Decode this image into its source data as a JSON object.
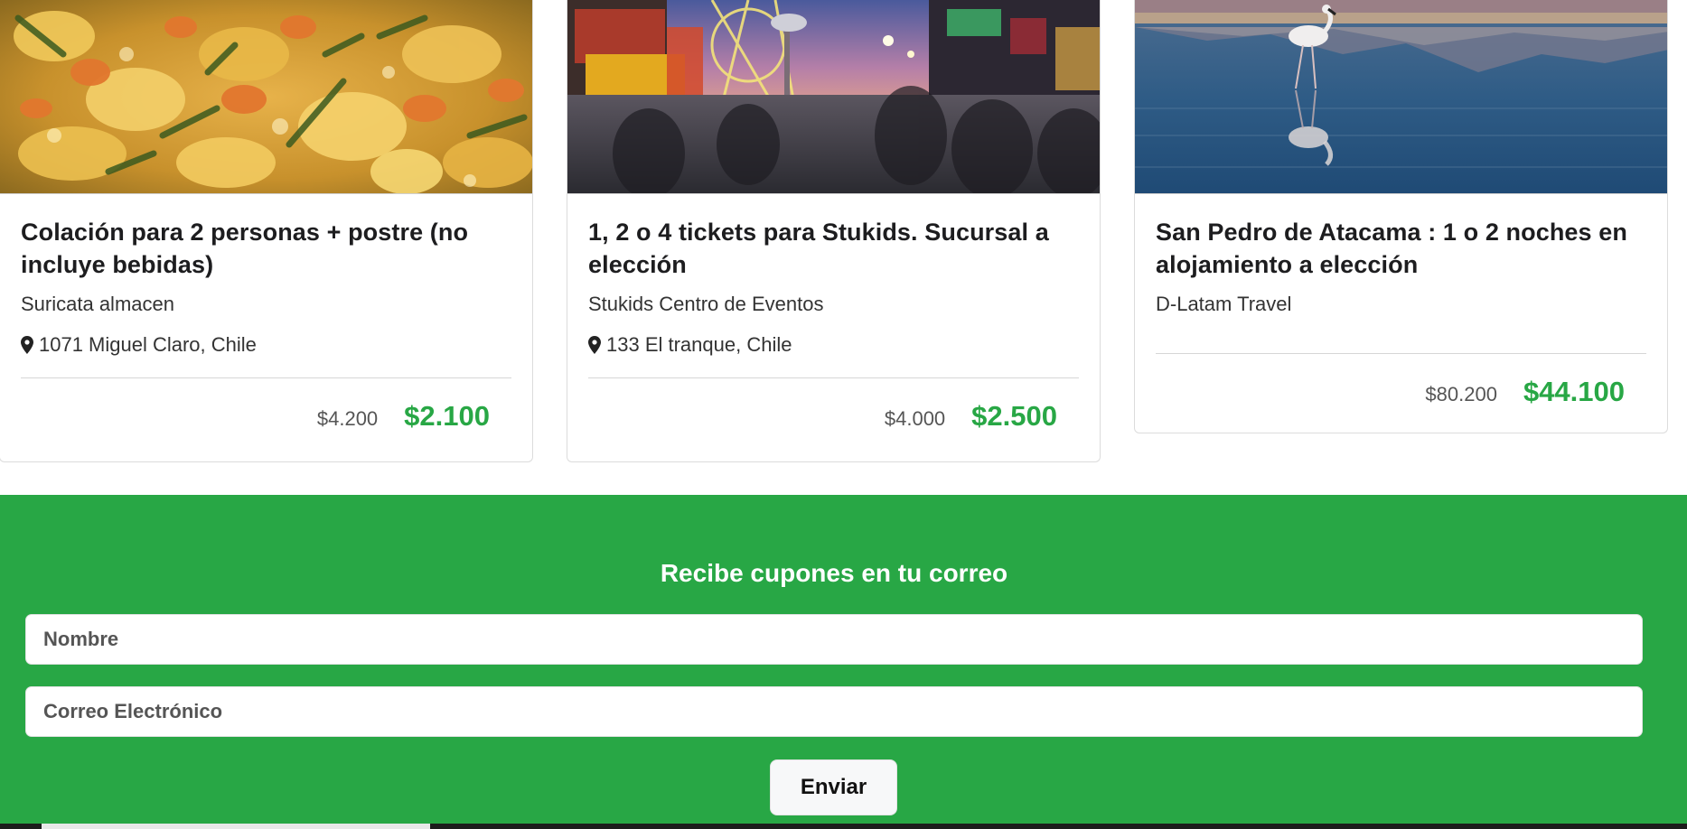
{
  "deals": [
    {
      "title": "Colación para 2 personas + postre (no incluye bebidas)",
      "merchant": "Suricata almacen",
      "location": "1071 Miguel Claro, Chile",
      "old_price": "$4.200",
      "new_price": "$2.100",
      "image": "food-photo"
    },
    {
      "title": "1, 2 o 4 tickets para Stukids. Sucursal a elección",
      "merchant": "Stukids Centro de Eventos",
      "location": "133 El tranque, Chile",
      "old_price": "$4.000",
      "new_price": "$2.500",
      "image": "amusement-park-photo"
    },
    {
      "title": "San Pedro de Atacama : 1 o 2 noches en alojamiento a elección",
      "merchant": "D-Latam Travel",
      "location": "",
      "old_price": "$80.200",
      "new_price": "$44.100",
      "image": "flamingo-lagoon-photo"
    }
  ],
  "newsletter": {
    "title": "Recibe cupones en tu correo",
    "name_placeholder": "Nombre",
    "email_placeholder": "Correo Electrónico",
    "submit_label": "Enviar"
  },
  "colors": {
    "accent_green": "#28a745",
    "price_green": "#28a745",
    "text_dark": "#1d1d1f"
  },
  "icons": {
    "location": "map-pin-icon"
  }
}
